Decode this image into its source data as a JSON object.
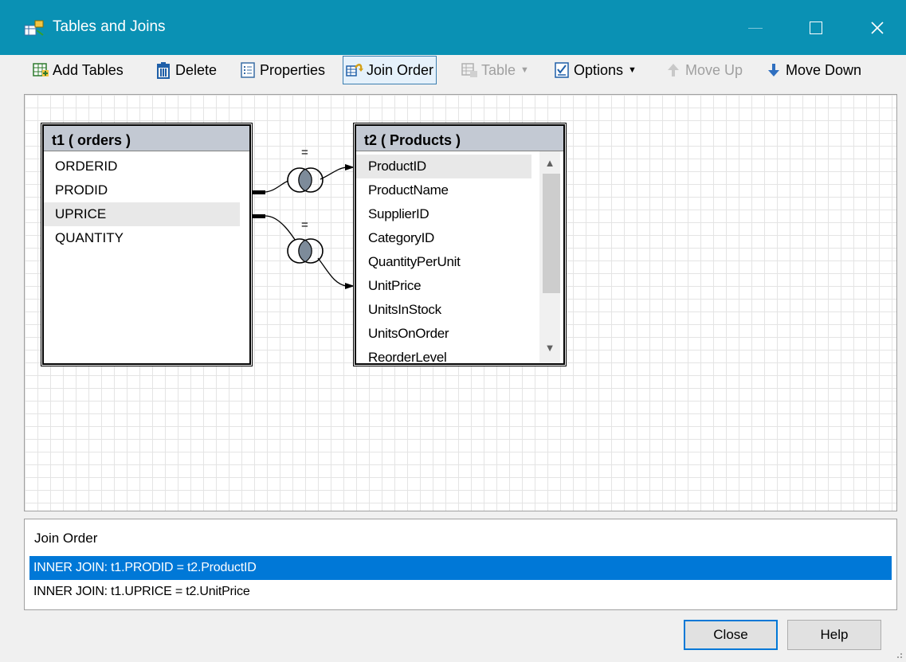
{
  "window": {
    "title": "Tables and Joins",
    "icon": "tables-joins-icon"
  },
  "toolbar": {
    "add_tables": "Add Tables",
    "delete": "Delete",
    "properties": "Properties",
    "join_order": "Join Order",
    "table": "Table",
    "options": "Options",
    "move_up": "Move Up",
    "move_down": "Move Down"
  },
  "tables": [
    {
      "title": "t1 ( orders )",
      "fields": [
        "ORDERID",
        "PRODID",
        "UPRICE",
        "QUANTITY"
      ],
      "selected": "UPRICE"
    },
    {
      "title": "t2 ( Products )",
      "fields": [
        "ProductID",
        "ProductName",
        "SupplierID",
        "CategoryID",
        "QuantityPerUnit",
        "UnitPrice",
        "UnitsInStock",
        "UnitsOnOrder",
        "ReorderLevel"
      ],
      "selected": "ProductID"
    }
  ],
  "joins": [
    {
      "operator": "="
    },
    {
      "operator": "="
    }
  ],
  "join_panel": {
    "heading": "Join Order",
    "rows": [
      "INNER JOIN: t1.PRODID = t2.ProductID",
      "INNER JOIN: t1.UPRICE = t2.UnitPrice"
    ],
    "selected_index": 0
  },
  "buttons": {
    "close": "Close",
    "help": "Help"
  },
  "colors": {
    "titlebar": "#0a91b4",
    "selection": "#0078d7",
    "table_header": "#c3c9d3"
  }
}
